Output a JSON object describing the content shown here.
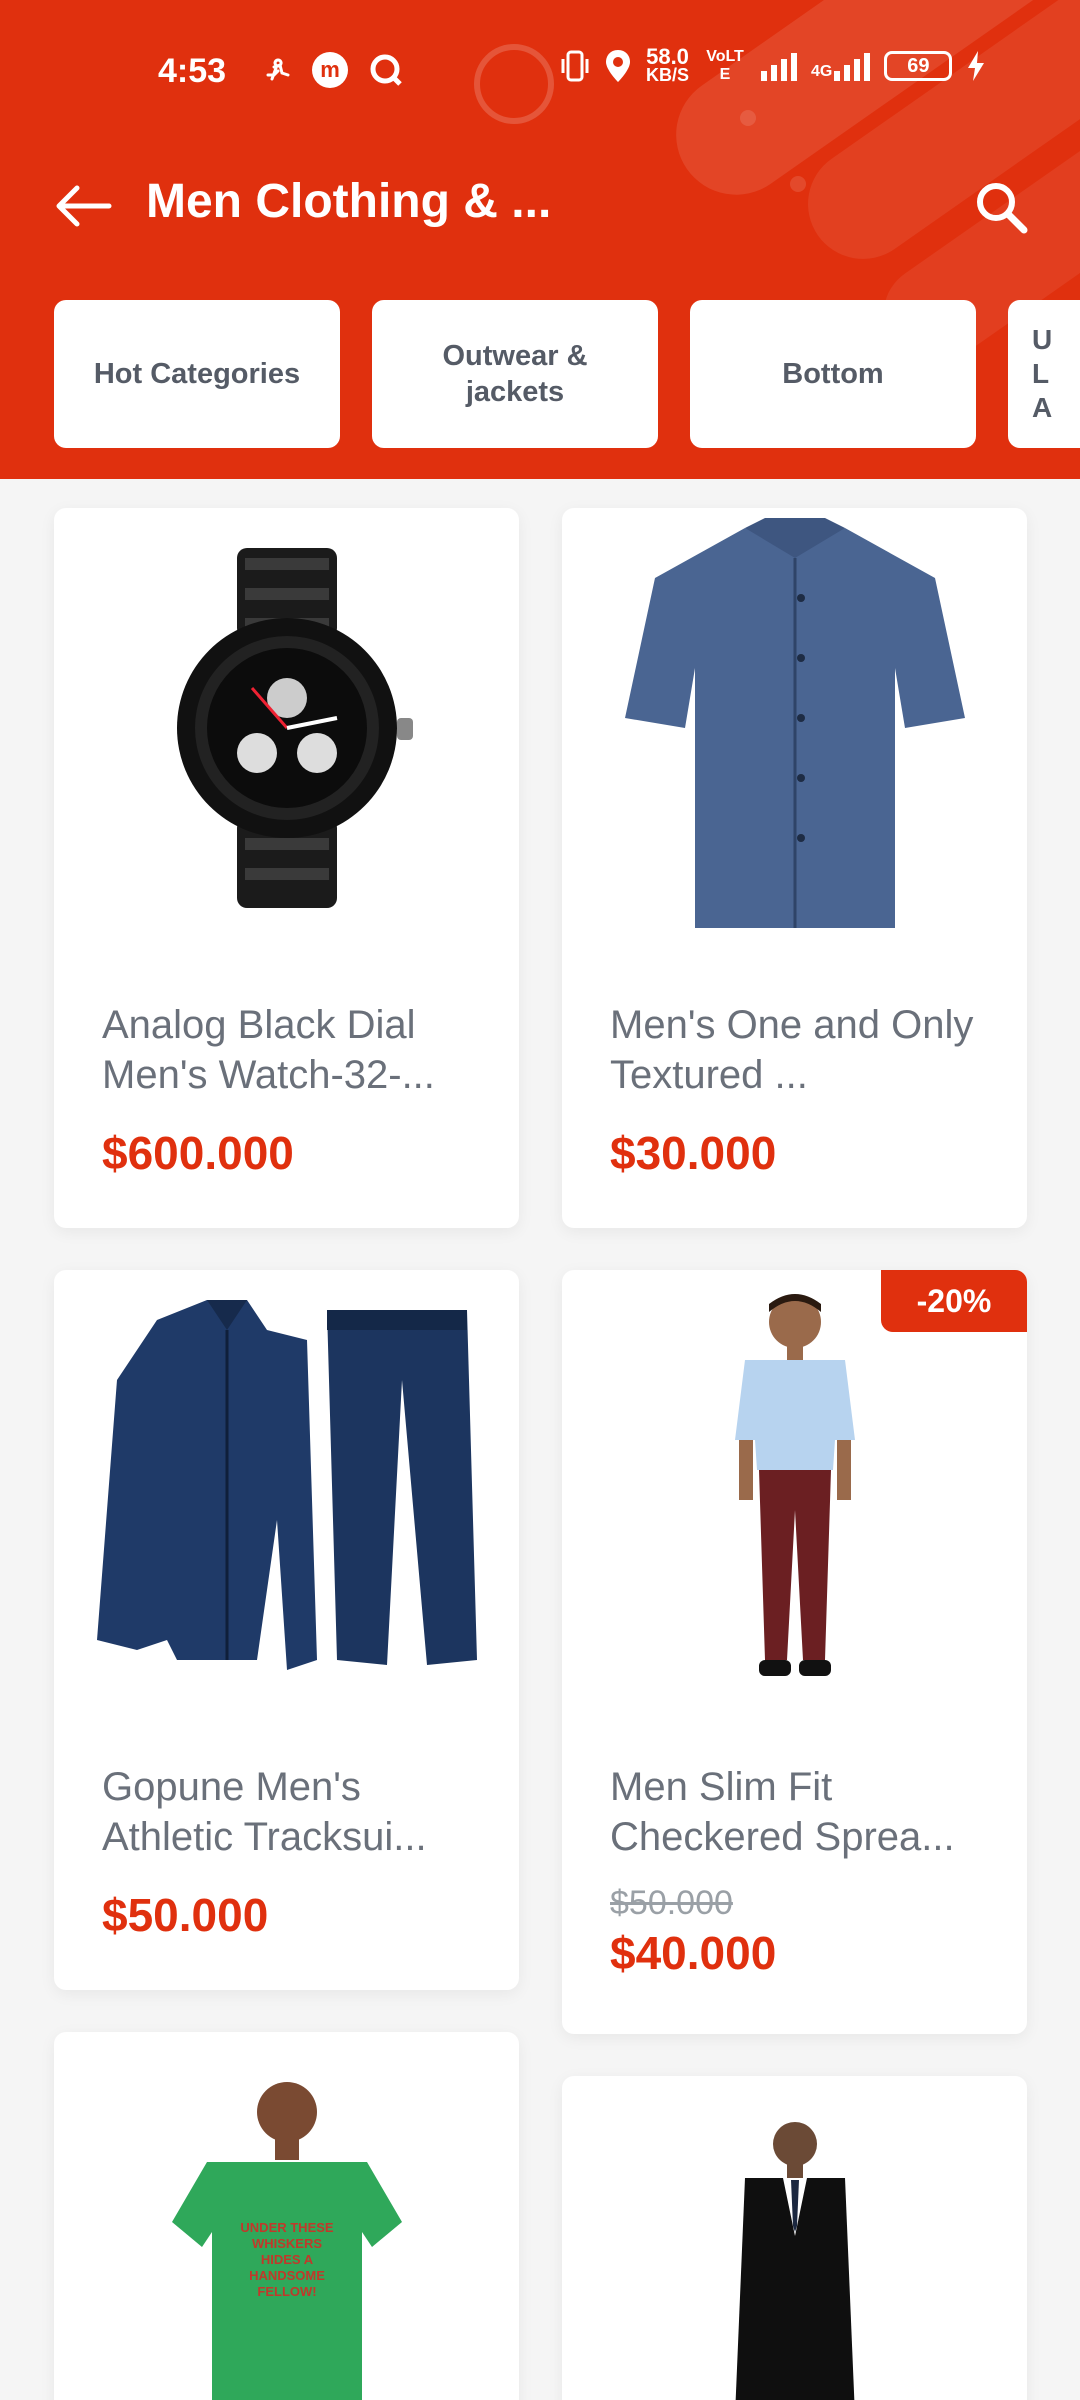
{
  "status_bar": {
    "time": "4:53",
    "speed_value": "58.0",
    "speed_unit": "KB/S",
    "volte": "VoLTE",
    "network": "4G",
    "battery": "69"
  },
  "toolbar": {
    "title": "Men Clothing & ..."
  },
  "categories": [
    {
      "label": "Hot Categories"
    },
    {
      "label": "Outwear & jackets"
    },
    {
      "label": "Bottom"
    },
    {
      "label": "U L A"
    }
  ],
  "products": [
    {
      "name": "Analog Black Dial Men's Watch-32-...",
      "price": "$600.000",
      "old_price": "",
      "badge": "",
      "icon": "watch-image"
    },
    {
      "name": "Men's One and Only Textured ...",
      "price": "$30.000",
      "old_price": "",
      "badge": "",
      "icon": "shirt-image"
    },
    {
      "name": "Gopune Men's Athletic Tracksui...",
      "price": "$50.000",
      "old_price": "",
      "badge": "",
      "icon": "tracksuit-image"
    },
    {
      "name": "Men Slim Fit Checkered Sprea...",
      "price": "$40.000",
      "old_price": "$50.000",
      "badge": "-20%",
      "icon": "model-shirt-image"
    },
    {
      "name": "",
      "price": "",
      "old_price": "",
      "badge": "",
      "icon": "green-tshirt-image",
      "print_text": "UNDER THESE WHISKERS HIDES A HANDSOME FELLOW!"
    },
    {
      "name": "",
      "price": "",
      "old_price": "",
      "badge": "",
      "icon": "black-suit-image"
    }
  ],
  "colors": {
    "brand": "#e0300e",
    "text_muted": "#6a707a"
  }
}
